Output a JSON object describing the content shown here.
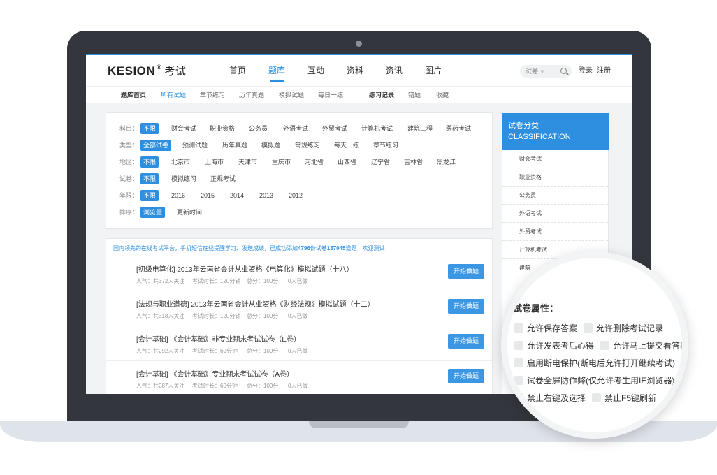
{
  "header": {
    "logo_text": "KESION",
    "logo_reg": "®",
    "logo_cn": "考试",
    "nav": [
      {
        "label": "首页"
      },
      {
        "label": "题库",
        "active": true
      },
      {
        "label": "互动"
      },
      {
        "label": "资料"
      },
      {
        "label": "资讯"
      },
      {
        "label": "图片"
      }
    ],
    "search_select": "试卷",
    "login": "登录",
    "register": "注册"
  },
  "subnav": {
    "items": [
      "题库首页",
      "所有试题",
      "章节练习",
      "历年真题",
      "模拟试题",
      "每日一练",
      "练习记录",
      "错题",
      "收藏"
    ]
  },
  "filters": [
    {
      "label": "科目：",
      "options": [
        "不限",
        "财会考试",
        "职业资格",
        "公务员",
        "外语考试",
        "外贸考试",
        "计算机考试",
        "建筑工程",
        "医药考试"
      ]
    },
    {
      "label": "类型：",
      "options": [
        "全部试卷",
        "预测试题",
        "历年真题",
        "模拟题",
        "常规练习",
        "每天一练",
        "章节练习"
      ]
    },
    {
      "label": "地区：",
      "options": [
        "不限",
        "北京市",
        "上海市",
        "天津市",
        "重庆市",
        "河北省",
        "山西省",
        "辽宁省",
        "吉林省",
        "黑龙江"
      ]
    },
    {
      "label": "试卷：",
      "options": [
        "不限",
        "模拟练习",
        "正规考试"
      ]
    },
    {
      "label": "年限：",
      "options": [
        "不限",
        "2016",
        "2015",
        "2014",
        "2013",
        "2012"
      ]
    },
    {
      "label": "排序：",
      "options": [
        "浏览量",
        "更新时间"
      ]
    }
  ],
  "notice": {
    "prefix": "国内领先的在线考试平台，手机短信在线提醒学习、发送成绩，已成功添加",
    "papers": "4796",
    "mid": "份试卷",
    "questions": "137045",
    "suffix": "道题，欢迎测试！"
  },
  "exams": [
    {
      "title": "[初级电算化] 2013年云南省会计从业资格《电算化》模拟试题（十八）",
      "popularity": "人气：共372人关注",
      "duration": "考试时长：120分钟",
      "score": "总分：100分",
      "done": "0人已做",
      "button": "开始做题"
    },
    {
      "title": "[法规与职业道德] 2013年云南省会计从业资格《财经法规》模拟试题（十二）",
      "popularity": "人气：共318人关注",
      "duration": "考试时长：120分钟",
      "score": "总分：100分",
      "done": "0人已做",
      "button": "开始做题"
    },
    {
      "title": "[会计基础] 《会计基础》非专业期末考试试卷（E卷）",
      "popularity": "人气：共292人关注",
      "duration": "考试时长：60分钟",
      "score": "总分：100分",
      "done": "0人已做",
      "button": "开始做题"
    },
    {
      "title": "[会计基础] 《会计基础》专业期末考试试卷（A卷）",
      "popularity": "人气：共287人关注",
      "duration": "考试时长：60分钟",
      "score": "总分：100分",
      "done": "0人已做",
      "button": "开始做题"
    }
  ],
  "sidebar": {
    "title_cn": "试卷分类",
    "title_en": "CLASSIFICATION",
    "items": [
      "财会考试",
      "职业资格",
      "公务员",
      "外语考试",
      "外贸考试",
      "计算机考试",
      "建筑"
    ]
  },
  "magnifier": {
    "title": "试卷属性：",
    "options": [
      "允许保存答案",
      "允许删除考试记录",
      "允许发表考后心得",
      "允许马上提交看答案",
      "启用断电保护(断电后允许打开继续考试)",
      "试卷全屏防作弊(仅允许考生用IE浏览器)",
      "禁止右键及选择",
      "禁止F5键刷新"
    ]
  }
}
